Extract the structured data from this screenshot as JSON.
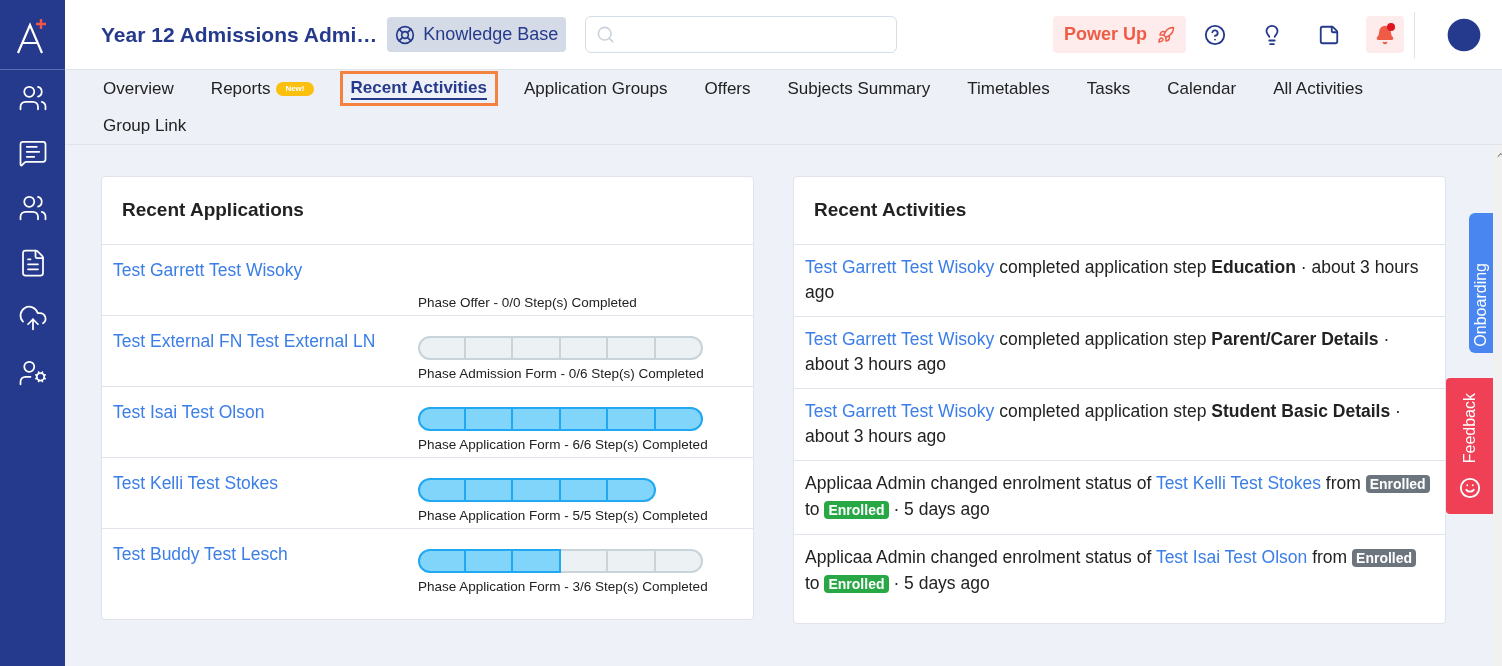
{
  "header": {
    "title": "Year 12 Admissions Admi…",
    "knowledge_base": "Knowledge Base",
    "power_up": "Power Up",
    "notifications_unread": true
  },
  "tabs": [
    {
      "label": "Overview",
      "selected": false
    },
    {
      "label": "Reports",
      "selected": false,
      "badge": "New!"
    },
    {
      "label": "Recent Activities",
      "selected": true
    },
    {
      "label": "Application Groups",
      "selected": false
    },
    {
      "label": "Offers",
      "selected": false
    },
    {
      "label": "Subjects Summary",
      "selected": false
    },
    {
      "label": "Timetables",
      "selected": false
    },
    {
      "label": "Tasks",
      "selected": false
    },
    {
      "label": "Calendar",
      "selected": false
    },
    {
      "label": "All Activities",
      "selected": false
    },
    {
      "label": "Group Link",
      "selected": false
    }
  ],
  "recent_applications": {
    "title": "Recent Applications",
    "rows": [
      {
        "name": "Test Garrett Test Wisoky",
        "phase": "Phase Offer - 0/0 Step(s) Completed"
      },
      {
        "name": "Test External FN Test External LN",
        "phase": "Phase Admission Form - 0/6 Step(s) Completed",
        "segments": [
          {
            "done": false
          },
          {
            "done": false
          },
          {
            "done": false
          },
          {
            "done": false
          },
          {
            "done": false
          },
          {
            "done": false
          }
        ]
      },
      {
        "name": "Test Isai Test Olson",
        "phase": "Phase Application Form - 6/6 Step(s) Completed",
        "segments": [
          {
            "done": true
          },
          {
            "done": true
          },
          {
            "done": true
          },
          {
            "done": true
          },
          {
            "done": true
          },
          {
            "done": true
          }
        ]
      },
      {
        "name": "Test Kelli Test Stokes",
        "phase": "Phase Application Form - 5/5 Step(s) Completed",
        "segments": [
          {
            "done": true
          },
          {
            "done": true
          },
          {
            "done": true
          },
          {
            "done": true
          },
          {
            "done": true
          }
        ]
      },
      {
        "name": "Test Buddy Test Lesch",
        "phase": "Phase Application Form - 3/6 Step(s) Completed",
        "segments": [
          {
            "done": true
          },
          {
            "done": true
          },
          {
            "done": true
          },
          {
            "done": false
          },
          {
            "done": false
          },
          {
            "done": false
          }
        ]
      }
    ]
  },
  "recent_activities": {
    "title": "Recent Activities",
    "items": [
      {
        "parts": [
          {
            "kind": "link",
            "text": "Test Garrett Test Wisoky"
          },
          {
            "kind": "text",
            "text": "completed application step **Education** · about 3 hours ago"
          }
        ]
      },
      {
        "parts": [
          {
            "kind": "link",
            "text": "Test Garrett Test Wisoky"
          },
          {
            "kind": "text",
            "text": "completed application step **Parent/Carer Details** · about 3 hours ago"
          }
        ]
      },
      {
        "parts": [
          {
            "kind": "link",
            "text": "Test Garrett Test Wisoky"
          },
          {
            "kind": "text",
            "text": "completed application step **Student Basic Details** · about 3 hours ago"
          }
        ]
      },
      {
        "parts": [
          {
            "kind": "text",
            "text": "Applicaa Admin changed enrolment status of"
          },
          {
            "kind": "link",
            "text": "Test Kelli Test Stokes"
          },
          {
            "kind": "text",
            "text": "from"
          },
          {
            "kind": "badge",
            "text": "Enrolled",
            "color": "#6c757d"
          },
          {
            "kind": "text",
            "text": "to"
          },
          {
            "kind": "badge",
            "text": "Enrolled",
            "color": "#28a745"
          },
          {
            "kind": "text",
            "text": "· 5 days ago"
          }
        ]
      },
      {
        "parts": [
          {
            "kind": "text",
            "text": "Applicaa Admin changed enrolment status of"
          },
          {
            "kind": "link",
            "text": "Test Isai Test Olson"
          },
          {
            "kind": "text",
            "text": "from"
          },
          {
            "kind": "badge",
            "text": "Enrolled",
            "color": "#6c757d"
          },
          {
            "kind": "text",
            "text": "to"
          },
          {
            "kind": "badge",
            "text": "Enrolled",
            "color": "#28a745"
          },
          {
            "kind": "text",
            "text": "· 5 days ago"
          }
        ]
      }
    ]
  },
  "side_tabs": [
    {
      "label": "Onboarding",
      "kind": "onboarding"
    },
    {
      "label": "Feedback",
      "kind": "feedback"
    }
  ]
}
